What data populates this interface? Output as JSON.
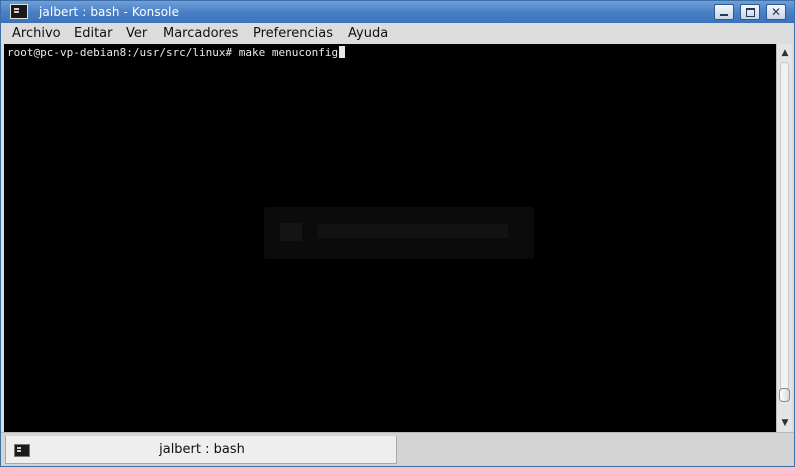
{
  "window": {
    "title": "jalbert : bash - Konsole",
    "title_bar_color": "#4a80c6"
  },
  "menubar": {
    "items": [
      "Archivo",
      "Editar",
      "Ver",
      "Marcadores",
      "Preferencias",
      "Ayuda"
    ]
  },
  "terminal": {
    "background": "#000000",
    "foreground": "#e8e8e8",
    "prompt": "root@pc-vp-debian8:/usr/src/linux#",
    "command": "make menuconfig"
  },
  "tabs": [
    {
      "label": "jalbert : bash",
      "icon": "terminal-icon"
    }
  ],
  "icons": {
    "app": "terminal-icon",
    "minimize": "minimize-icon",
    "maximize": "maximize-icon",
    "close": "close-icon",
    "close_glyph": "✕",
    "scroll_up_glyph": "▲",
    "scroll_down_glyph": "▼"
  }
}
